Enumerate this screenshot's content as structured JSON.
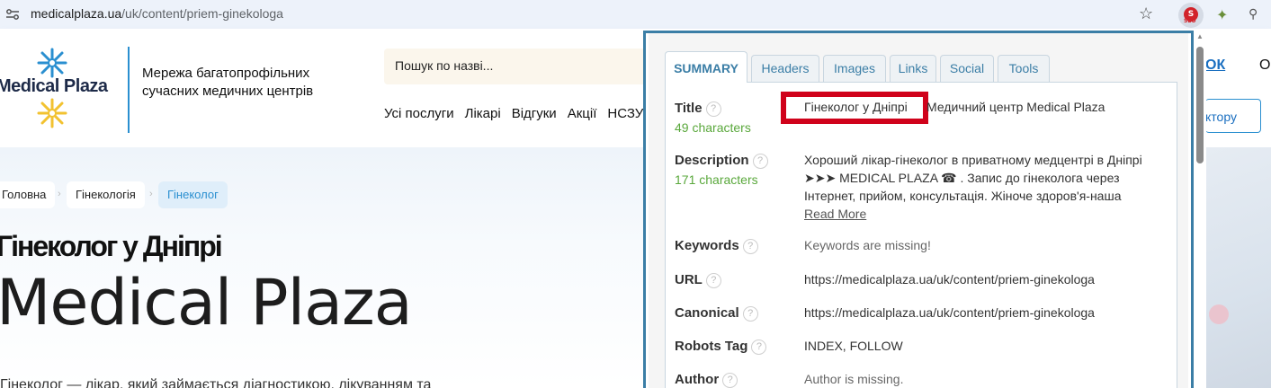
{
  "browser": {
    "url_host": "medicalplaza.ua",
    "url_path": "/uk/content/priem-ginekologa",
    "star_icon": "star-icon",
    "extensions": [
      {
        "name": "seo-extension-icon",
        "label": "S",
        "sub": "SEO"
      },
      {
        "name": "puzzle-extension-icon",
        "label": "✦"
      },
      {
        "name": "search-extension-icon",
        "label": "🔍"
      }
    ]
  },
  "site": {
    "logo_text": "Medical Plaza",
    "tagline": "Мережа багатопрофільних сучасних медичних центрів",
    "search_placeholder": "Пошук по назві...",
    "nav": [
      "Усі послуги",
      "Лікарі",
      "Відгуки",
      "Акції",
      "НСЗУ"
    ],
    "right_link": "ОК",
    "right_letter": "О",
    "right_button": "ктору",
    "brand_color": "#2a8fd0"
  },
  "page": {
    "breadcrumbs": [
      "Головна",
      "Гінекологія",
      "Гінеколог"
    ],
    "h1_line1": "Гінеколог у Дніпрі",
    "h1_line2": "Medical Plaza",
    "body_start": "Гінеколог — лікар, який займається діагностикою, лікуванням та"
  },
  "seo_popup": {
    "tabs": [
      "SUMMARY",
      "Headers",
      "Images",
      "Links",
      "Social",
      "Tools"
    ],
    "active_tab": "SUMMARY",
    "rows": {
      "title": {
        "label": "Title",
        "count": "49 characters",
        "value_highlighted": "Гінеколог у Дніпрі",
        "value_rest": "Медичний центр Medical Plaza"
      },
      "description": {
        "label": "Description",
        "count": "171 characters",
        "value": "Хороший лікар-гінеколог в приватному медцентрі в Дніпрі ➤➤➤ MEDICAL PLAZA ☎ . Запис до гінеколога через Інтернет, прийом, консультація. Жіноче здоров'я-наша",
        "read_more": "Read More"
      },
      "keywords": {
        "label": "Keywords",
        "value": "Keywords are missing!"
      },
      "url": {
        "label": "URL",
        "value": "https://medicalplaza.ua/uk/content/priem-ginekologa"
      },
      "canonical": {
        "label": "Canonical",
        "value": "https://medicalplaza.ua/uk/content/priem-ginekologa"
      },
      "robots": {
        "label": "Robots Tag",
        "value": "INDEX, FOLLOW"
      },
      "author": {
        "label": "Author",
        "value": "Author is missing."
      }
    },
    "help_glyph": "?",
    "accent_color": "#3b7ea6",
    "count_color": "#5aa83c",
    "highlight_color": "#d0021b"
  }
}
